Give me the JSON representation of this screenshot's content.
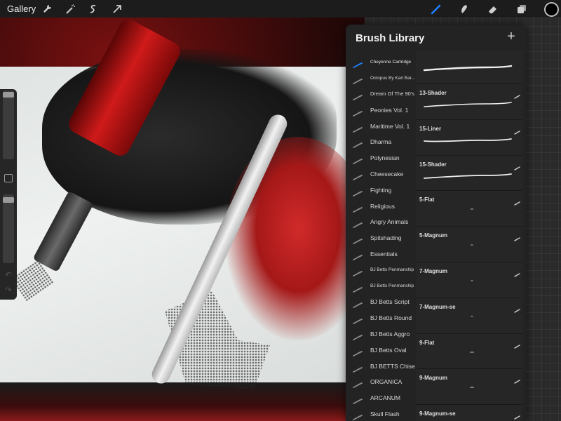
{
  "toolbar": {
    "gallery_label": "Gallery",
    "icons": [
      "wrench-icon",
      "magic-wand-icon",
      "selection-icon",
      "transform-arrow-icon"
    ],
    "tools": [
      "brush-tool-icon",
      "smudge-tool-icon",
      "eraser-tool-icon",
      "layers-icon"
    ],
    "active_tool": "brush-tool-icon",
    "accent_color": "#1f7fff",
    "current_color": "#000000"
  },
  "brush_library": {
    "title": "Brush Library",
    "add_label": "+",
    "sets": [
      {
        "label": "Cheyenne Cartridge",
        "active": true
      },
      {
        "label": "Octopus By Karl Bar..."
      },
      {
        "label": "Dream Of The 90's"
      },
      {
        "label": "Peonies Vol. 1"
      },
      {
        "label": "Maritime Vol. 1"
      },
      {
        "label": "Dharma"
      },
      {
        "label": "Polynesian"
      },
      {
        "label": "Cheesecake"
      },
      {
        "label": "Fighting"
      },
      {
        "label": "Religious"
      },
      {
        "label": "Angry Animals"
      },
      {
        "label": "Spitshading"
      },
      {
        "label": "Essentials"
      },
      {
        "label": "BJ Betts Penmanship"
      },
      {
        "label": "BJ Betts Penmanship"
      },
      {
        "label": "BJ Betts Script"
      },
      {
        "label": "BJ Betts Round"
      },
      {
        "label": "BJ Betts Aggro"
      },
      {
        "label": "BJ Betts Oval"
      },
      {
        "label": "BJ BETTS Chisel"
      },
      {
        "label": "ORGANICA"
      },
      {
        "label": "ARCANUM"
      },
      {
        "label": "Skull Flash"
      }
    ],
    "brushes": [
      {
        "name": ""
      },
      {
        "name": "13-Shader"
      },
      {
        "name": "15-Liner"
      },
      {
        "name": "15-Shader"
      },
      {
        "name": "5-Flat"
      },
      {
        "name": "5-Magnum"
      },
      {
        "name": "7-Magnum"
      },
      {
        "name": "7-Magnum-se"
      },
      {
        "name": "9-Flat"
      },
      {
        "name": "9-Magnum"
      },
      {
        "name": "9-Magnum-se"
      }
    ]
  }
}
